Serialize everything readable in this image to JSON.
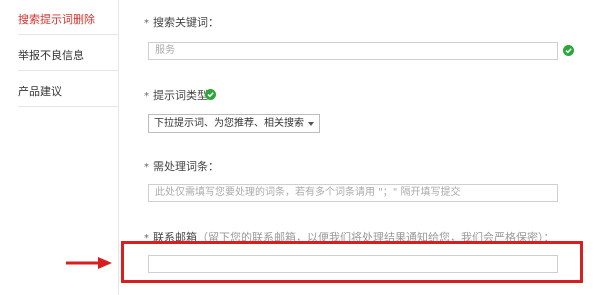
{
  "sidebar": {
    "items": [
      {
        "label": "搜索提示词删除",
        "active": true
      },
      {
        "label": "举报不良信息",
        "active": false
      },
      {
        "label": "产品建议",
        "active": false
      }
    ]
  },
  "form": {
    "keyword": {
      "label": "搜索关键词：",
      "placeholder": "服务"
    },
    "type": {
      "label": "提示词类型：",
      "selected": "下拉提示词、为您推荐、相关搜索"
    },
    "pending": {
      "label": "需处理词条：",
      "placeholder": "此处仅需填写您要处理的词条，若有多个词条请用 \"；\" 隔开填写提交"
    },
    "email": {
      "label": "联系邮箱",
      "hint": "（留下您的联系邮箱，以便我们将处理结果通知给您，我们会严格保密）：",
      "placeholder": ""
    }
  },
  "colors": {
    "accent": "#d3322c",
    "check": "#2ca63a",
    "highlight": "#d81e1e"
  },
  "icons": {
    "valid": "check-circle-icon",
    "pointer": "arrow-right-icon"
  }
}
